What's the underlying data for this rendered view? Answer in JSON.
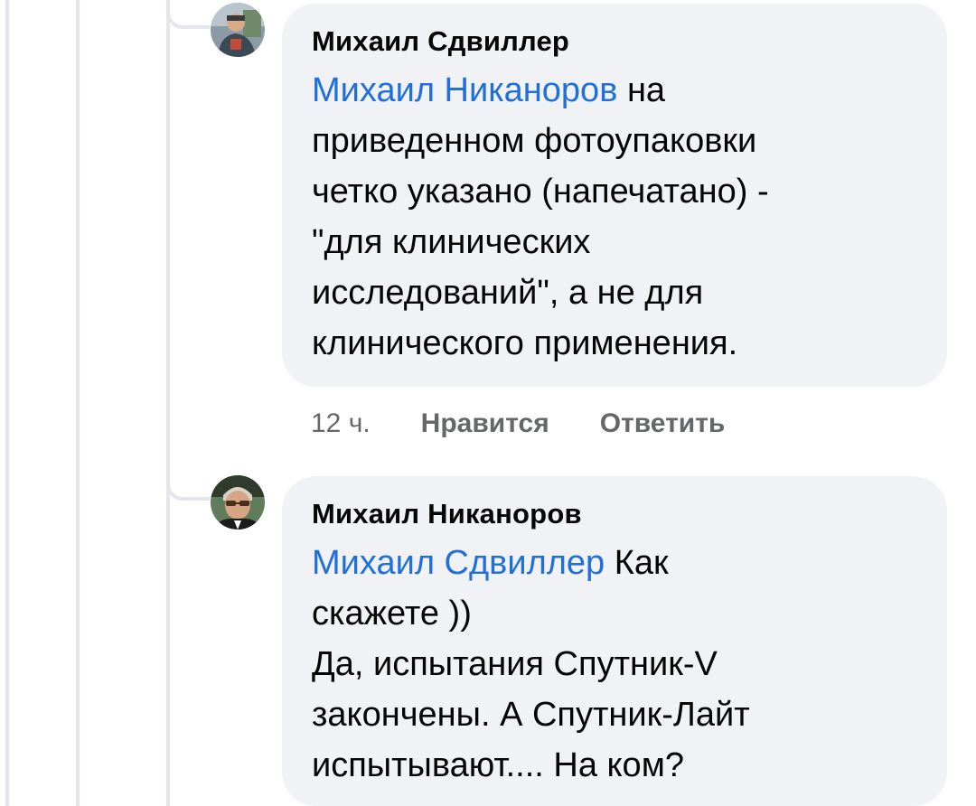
{
  "comments": [
    {
      "author": "Михаил Сдвиллер",
      "mention": "Михаил Никаноров",
      "text": " на\nприведенном фотоупаковки\nчетко указано (напечатано) -\n\"для клинических\nисследований\", а не для\nклинического применения.",
      "time": "12 ч.",
      "like_label": "Нравится",
      "reply_label": "Ответить"
    },
    {
      "author": "Михаил Никаноров",
      "mention": "Михаил Сдвиллер",
      "text": " Как\nскажете ))\nДа, испытания Спутник-V\nзакончены. А Спутник-Лайт\nиспытывают.... На ком?"
    }
  ],
  "colors": {
    "mention": "#216fdb",
    "bubble": "#f0f2f5",
    "meta": "#65676b"
  }
}
